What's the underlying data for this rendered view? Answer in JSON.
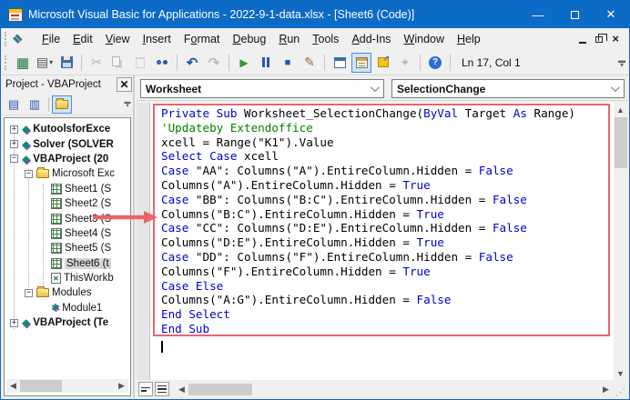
{
  "window": {
    "title": "Microsoft Visual Basic for Applications - 2022-9-1-data.xlsx - [Sheet6 (Code)]",
    "controls": {
      "minimize": "—",
      "close": "✕"
    }
  },
  "menu": {
    "items": [
      {
        "label": "File",
        "accel": 0
      },
      {
        "label": "Edit",
        "accel": 0
      },
      {
        "label": "View",
        "accel": 0
      },
      {
        "label": "Insert",
        "accel": 0
      },
      {
        "label": "Format",
        "accel": 1
      },
      {
        "label": "Debug",
        "accel": 0
      },
      {
        "label": "Run",
        "accel": 0
      },
      {
        "label": "Tools",
        "accel": 0
      },
      {
        "label": "Add-Ins",
        "accel": 0
      },
      {
        "label": "Window",
        "accel": 0
      },
      {
        "label": "Help",
        "accel": 0
      }
    ]
  },
  "toolbar": {
    "position_label": "Ln 17, Col 1",
    "groups": [
      [
        {
          "name": "view-excel"
        },
        {
          "name": "view-object-dropdown"
        },
        {
          "name": "save"
        }
      ],
      [
        {
          "name": "cut",
          "disabled": true
        },
        {
          "name": "copy",
          "disabled": true
        },
        {
          "name": "paste",
          "disabled": true
        },
        {
          "name": "find"
        }
      ],
      [
        {
          "name": "undo"
        },
        {
          "name": "redo",
          "disabled": true
        }
      ],
      [
        {
          "name": "run"
        },
        {
          "name": "break"
        },
        {
          "name": "reset"
        },
        {
          "name": "design-mode"
        }
      ],
      [
        {
          "name": "project-explorer"
        },
        {
          "name": "properties-window",
          "active": true
        },
        {
          "name": "object-browser"
        },
        {
          "name": "toolbox",
          "disabled": true
        }
      ],
      [
        {
          "name": "help"
        }
      ]
    ]
  },
  "project_panel": {
    "title": "Project - VBAProject",
    "toolbar": [
      {
        "name": "view-code"
      },
      {
        "name": "view-object"
      },
      {
        "name": "toggle-folders",
        "active": true
      }
    ],
    "tree": [
      {
        "label": "KutoolsforExce",
        "level": 0,
        "expander": "+",
        "icon": "project",
        "bold": true
      },
      {
        "label": "Solver (SOLVER",
        "level": 0,
        "expander": "+",
        "icon": "project",
        "bold": true
      },
      {
        "label": "VBAProject (20",
        "level": 0,
        "expander": "-",
        "icon": "project",
        "bold": true
      },
      {
        "label": "Microsoft Exc",
        "level": 1,
        "expander": "-",
        "icon": "folder"
      },
      {
        "label": "Sheet1 (S",
        "level": 2,
        "icon": "sheet"
      },
      {
        "label": "Sheet2 (S",
        "level": 2,
        "icon": "sheet"
      },
      {
        "label": "Sheet3 (S",
        "level": 2,
        "icon": "sheet"
      },
      {
        "label": "Sheet4 (S",
        "level": 2,
        "icon": "sheet"
      },
      {
        "label": "Sheet5 (S",
        "level": 2,
        "icon": "sheet"
      },
      {
        "label": "Sheet6 (t",
        "level": 2,
        "icon": "sheet",
        "selected": true
      },
      {
        "label": "ThisWorkb",
        "level": 2,
        "icon": "workbook"
      },
      {
        "label": "Modules",
        "level": 1,
        "expander": "-",
        "icon": "folder"
      },
      {
        "label": "Module1",
        "level": 2,
        "icon": "module"
      },
      {
        "label": "VBAProject (Te",
        "level": 0,
        "expander": "+",
        "icon": "project",
        "bold": true
      }
    ]
  },
  "code_window": {
    "object_dropdown": "Worksheet",
    "procedure_dropdown": "SelectionChange",
    "lines": [
      [
        [
          "k",
          "Private"
        ],
        [
          "t",
          " "
        ],
        [
          "k",
          "Sub"
        ],
        [
          "t",
          " Worksheet_SelectionChange("
        ],
        [
          "k",
          "ByVal"
        ],
        [
          "t",
          " Target "
        ],
        [
          "k",
          "As"
        ],
        [
          "t",
          " Range)"
        ]
      ],
      [
        [
          "c",
          "'Updateby Extendoffice"
        ]
      ],
      [
        [
          "t",
          "xcell = Range(\"K1\").Value"
        ]
      ],
      [
        [
          "k",
          "Select"
        ],
        [
          "t",
          " "
        ],
        [
          "k",
          "Case"
        ],
        [
          "t",
          " xcell"
        ]
      ],
      [
        [
          "k",
          "Case"
        ],
        [
          "t",
          " \"AA\": Columns(\"A\").EntireColumn.Hidden = "
        ],
        [
          "k",
          "False"
        ]
      ],
      [
        [
          "t",
          "Columns(\"A\").EntireColumn.Hidden = "
        ],
        [
          "k",
          "True"
        ]
      ],
      [
        [
          "k",
          "Case"
        ],
        [
          "t",
          " \"BB\": Columns(\"B:C\").EntireColumn.Hidden = "
        ],
        [
          "k",
          "False"
        ]
      ],
      [
        [
          "t",
          "Columns(\"B:C\").EntireColumn.Hidden = "
        ],
        [
          "k",
          "True"
        ]
      ],
      [
        [
          "k",
          "Case"
        ],
        [
          "t",
          " \"CC\": Columns(\"D:E\").EntireColumn.Hidden = "
        ],
        [
          "k",
          "False"
        ]
      ],
      [
        [
          "t",
          "Columns(\"D:E\").EntireColumn.Hidden = "
        ],
        [
          "k",
          "True"
        ]
      ],
      [
        [
          "k",
          "Case"
        ],
        [
          "t",
          " \"DD\": Columns(\"F\").EntireColumn.Hidden = "
        ],
        [
          "k",
          "False"
        ]
      ],
      [
        [
          "t",
          "Columns(\"F\").EntireColumn.Hidden = "
        ],
        [
          "k",
          "True"
        ]
      ],
      [
        [
          "k",
          "Case Else"
        ]
      ],
      [
        [
          "t",
          "Columns(\"A:G\").EntireColumn.Hidden = "
        ],
        [
          "k",
          "False"
        ]
      ],
      [
        [
          "k",
          "End Select"
        ]
      ],
      [
        [
          "k",
          "End Sub"
        ]
      ]
    ]
  },
  "colors": {
    "titlebar_blue": "#0b6bc7",
    "keyword_blue": "#0000d4",
    "comment_green": "#008000",
    "annotation_red": "#e8646e"
  }
}
